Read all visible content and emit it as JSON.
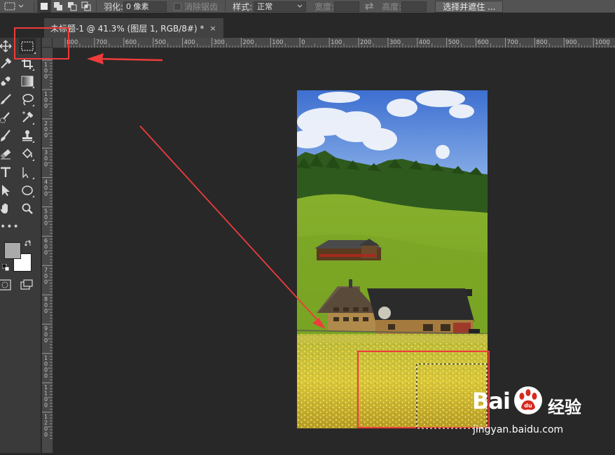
{
  "options_bar": {
    "feather_label": "羽化:",
    "feather_value": "0 像素",
    "antialias_label": "消除锯齿",
    "style_label": "样式:",
    "style_value": "正常",
    "width_label": "宽度:",
    "height_label": "高度:",
    "select_mask_button": "选择并遮住 ..."
  },
  "document_tab": {
    "title": "未标题-1 @ 41.3% (图层 1, RGB/8#) *",
    "close": "×"
  },
  "ruler": {
    "top_labels": [
      "800",
      "700",
      "600",
      "500",
      "400",
      "300",
      "200",
      "100",
      "0",
      "100",
      "200",
      "300",
      "400",
      "500",
      "600",
      "700",
      "800",
      "900",
      "1000"
    ],
    "left_labels": [
      "100",
      "100",
      "200",
      "300",
      "400",
      "500",
      "600",
      "700",
      "800",
      "900",
      "1000",
      "1100",
      "1200"
    ]
  },
  "toolbar": {
    "tools": [
      "move-tool",
      "rectangular-marquee-tool",
      "eyedropper-tool",
      "crop-tool",
      "healing-brush-tool",
      "gradient-tool",
      "brush-tool",
      "lasso-tool",
      "quick-selection-tool",
      "color-sampler-tool",
      "history-brush-tool",
      "stamp-tool",
      "eraser-tool",
      "paint-bucket-tool",
      "type-tool",
      "path-selection-tool",
      "direct-selection-tool",
      "ellipse-tool",
      "hand-tool",
      "zoom-tool"
    ],
    "more": "•••"
  },
  "colors": {
    "foreground": "#aaaaaa",
    "background": "#ffffff",
    "annotation": "#ef3b3b"
  },
  "watermark": {
    "logo_text": "Bai",
    "logo_suffix": "du",
    "chinese": "经验",
    "url": "jingyan.baidu.com"
  }
}
